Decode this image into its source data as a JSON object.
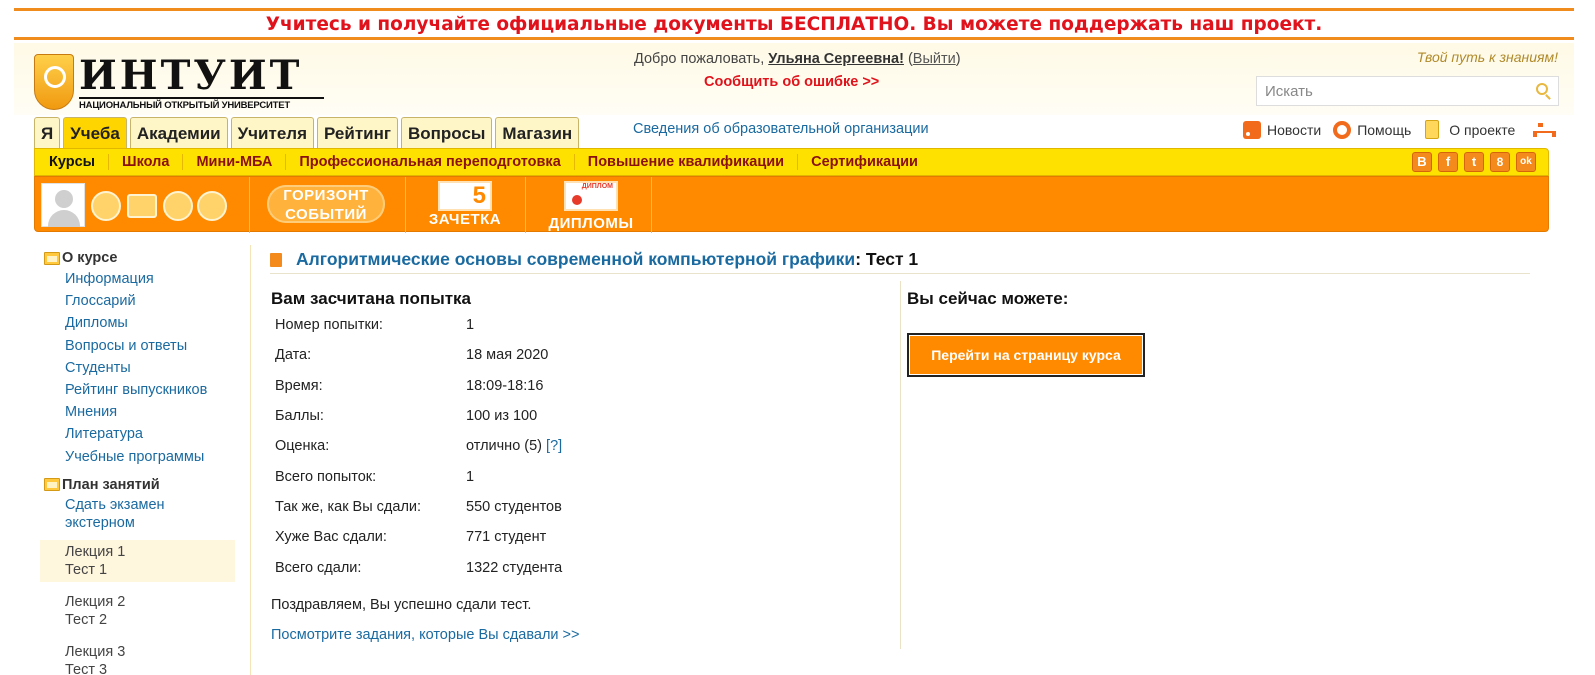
{
  "promo": {
    "text": "Учитесь и получайте официальные документы БЕСПЛАТНО. Вы можете поддержать наш проект."
  },
  "header": {
    "logo_title": "ИНТУИТ",
    "logo_subtitle": "НАЦИОНАЛЬНЫЙ ОТКРЫТЫЙ УНИВЕРСИТЕТ",
    "welcome_prefix": "Добро пожаловать, ",
    "user_name": "Ульяна Сергеевна!",
    "logout_open": " (",
    "logout_label": "Выйти",
    "logout_close": ")",
    "report_error": "Сообщить об ошибке >>",
    "motto": "Твой путь к знаниям!",
    "search_placeholder": "Искать"
  },
  "tabs": [
    {
      "label": "Я",
      "active": false
    },
    {
      "label": "Учеба",
      "active": true
    },
    {
      "label": "Академии",
      "active": false
    },
    {
      "label": "Учителя",
      "active": false
    },
    {
      "label": "Рейтинг",
      "active": false
    },
    {
      "label": "Вопросы",
      "active": false
    },
    {
      "label": "Магазин",
      "active": false
    }
  ],
  "org_info_link": "Сведения об образовательной организации",
  "top_links": {
    "news": "Новости",
    "help": "Помощь",
    "about": "О проекте"
  },
  "subnav": [
    "Курсы",
    "Школа",
    "Мини-МБА",
    "Профессиональная переподготовка",
    "Повышение квалификации",
    "Сертификации"
  ],
  "social": [
    "В",
    "f",
    "t",
    "8",
    "ok"
  ],
  "band": {
    "horizon_line1": "ГОРИЗОНТ",
    "horizon_line2": "СОБЫТИЙ",
    "zachet_num": "5",
    "zachet_label": "ЗАЧЕТКА",
    "diplomas_doc": "ДИПЛОМ",
    "diplomas_label": "ДИПЛОМЫ"
  },
  "sidebar": {
    "about_title": "О курсе",
    "about_links": [
      "Информация",
      "Глоссарий",
      "Дипломы",
      "Вопросы и ответы",
      "Студенты",
      "Рейтинг выпускников",
      "Мнения",
      "Литература",
      "Учебные программы"
    ],
    "plan_title": "План занятий",
    "exam_link_line1": "Сдать экзамен",
    "exam_link_line2": "экстерном",
    "lectures": [
      {
        "lecture": "Лекция 1",
        "test": "Тест 1",
        "highlighted": true
      },
      {
        "lecture": "Лекция 2",
        "test": "Тест 2",
        "highlighted": false
      },
      {
        "lecture": "Лекция 3",
        "test": "Тест 3",
        "highlighted": false
      }
    ]
  },
  "main": {
    "course_title": "Алгоритмические основы современной компьютерной графики",
    "test_suffix": ": Тест 1",
    "attempt_heading": "Вам засчитана попытка",
    "results": [
      {
        "key": "Номер попытки:",
        "value": "1"
      },
      {
        "key": "Дата:",
        "value": "18 мая 2020"
      },
      {
        "key": "Время:",
        "value": "18:09-18:16"
      },
      {
        "key": "Баллы:",
        "value": "100 из 100"
      },
      {
        "key": "Оценка:",
        "value": "отлично (5)",
        "help": "[?]"
      },
      {
        "key": "Всего попыток:",
        "value": "1"
      },
      {
        "key": "Так же, как Вы сдали:",
        "value": "550 студентов"
      },
      {
        "key": "Хуже Вас сдали:",
        "value": "771 студент"
      },
      {
        "key": "Всего сдали:",
        "value": "1322 студента"
      }
    ],
    "congrats": "Поздравляем, Вы успешно сдали тест.",
    "view_tasks_link": "Посмотрите задания, которые Вы сдавали >>",
    "right_heading": "Вы сейчас можете:",
    "go_course_button": "Перейти на страницу курса"
  }
}
